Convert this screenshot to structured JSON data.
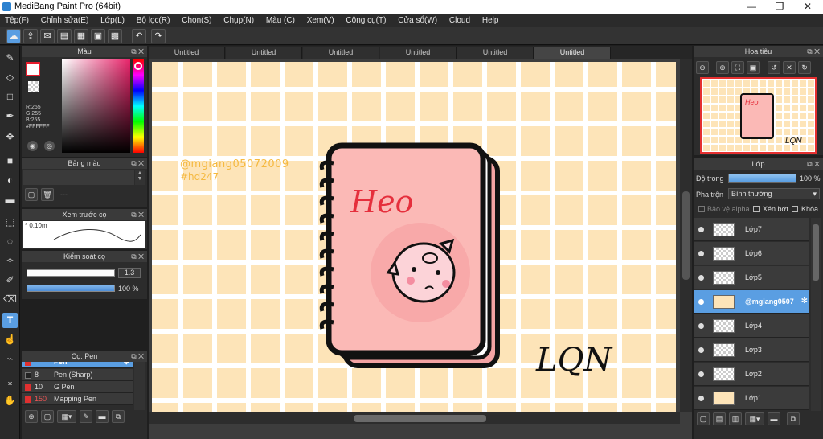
{
  "window": {
    "title": "MediBang Paint Pro (64bit)",
    "minimize": "—",
    "maximize": "❐",
    "close": "✕"
  },
  "menu": [
    "Tệp(F)",
    "Chỉnh sửa(E)",
    "Lớp(L)",
    "Bộ lọc(R)",
    "Chọn(S)",
    "Chụp(N)",
    "Màu (C)",
    "Xem(V)",
    "Công cụ(T)",
    "Cửa sổ(W)",
    "Cloud",
    "Help"
  ],
  "color_panel": {
    "title": "Màu",
    "r": "R:255",
    "g": "G:255",
    "b": "B:255",
    "hex": "#FFFFFF",
    "primary": "#e81c2c",
    "secondary": "#ffffff"
  },
  "palette_panel": {
    "title": "Bảng màu",
    "dash": "---"
  },
  "brush_preview": {
    "title": "Xem trước cọ",
    "size": "* 0.10m"
  },
  "brush_control": {
    "title": "Kiểm soát cọ",
    "size_value": "1.3",
    "opacity_value": "100 %"
  },
  "brush_list": {
    "title": "Cọ: Pen",
    "items": [
      {
        "size": "",
        "name": "Pen",
        "color": "#e03030"
      },
      {
        "size": "8",
        "name": "Pen (Sharp)",
        "color": "#222222"
      },
      {
        "size": "10",
        "name": "G Pen",
        "color": "#e03030"
      },
      {
        "size": "150",
        "name": "Mapping Pen",
        "color": "#e03030"
      }
    ]
  },
  "tabs": [
    "Untitled",
    "Untitled",
    "Untitled",
    "Untitled",
    "Untitled",
    "Untitled"
  ],
  "canvas": {
    "watermark_line1": "@mgiang05072009",
    "watermark_line2": "#hd247",
    "notebook_title": "Heo",
    "signature": "LQN"
  },
  "navigator": {
    "title": "Hoa tiêu",
    "mini_title": "Heo",
    "mini_signature": "LQN"
  },
  "layers_panel": {
    "title": "Lớp",
    "opacity_label": "Độ trong",
    "opacity_value": "100 %",
    "opacity_fraction": 1.0,
    "blend_label": "Pha trộn",
    "blend_value": "Bình thường",
    "protect_alpha": "Bảo vệ alpha",
    "clipping": "Xén bớt",
    "lock": "Khóa",
    "layers": [
      "Lớp7",
      "Lớp6",
      "Lớp5",
      "@mgiang0507",
      "Lớp4",
      "Lớp3",
      "Lớp2",
      "Lớp1"
    ],
    "selected_index": 3
  }
}
